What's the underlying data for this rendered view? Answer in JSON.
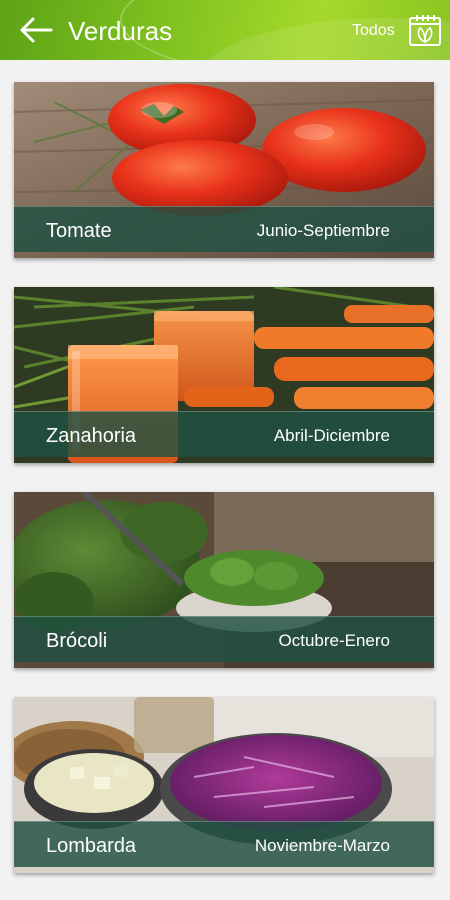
{
  "header": {
    "title": "Verduras",
    "filter_label": "Todos",
    "back_icon": "arrow-left-icon",
    "calendar_icon": "calendar-leaf-icon"
  },
  "colors": {
    "appbar_primary": "#6db31b",
    "label_band": "#205042",
    "background": "#f2f2f2"
  },
  "vegetables": [
    {
      "name": "Tomate",
      "season": "Junio-Septiembre"
    },
    {
      "name": "Zanahoria",
      "season": "Abril-Diciembre"
    },
    {
      "name": "Brócoli",
      "season": "Octubre-Enero"
    },
    {
      "name": "Lombarda",
      "season": "Noviembre-Marzo"
    }
  ]
}
